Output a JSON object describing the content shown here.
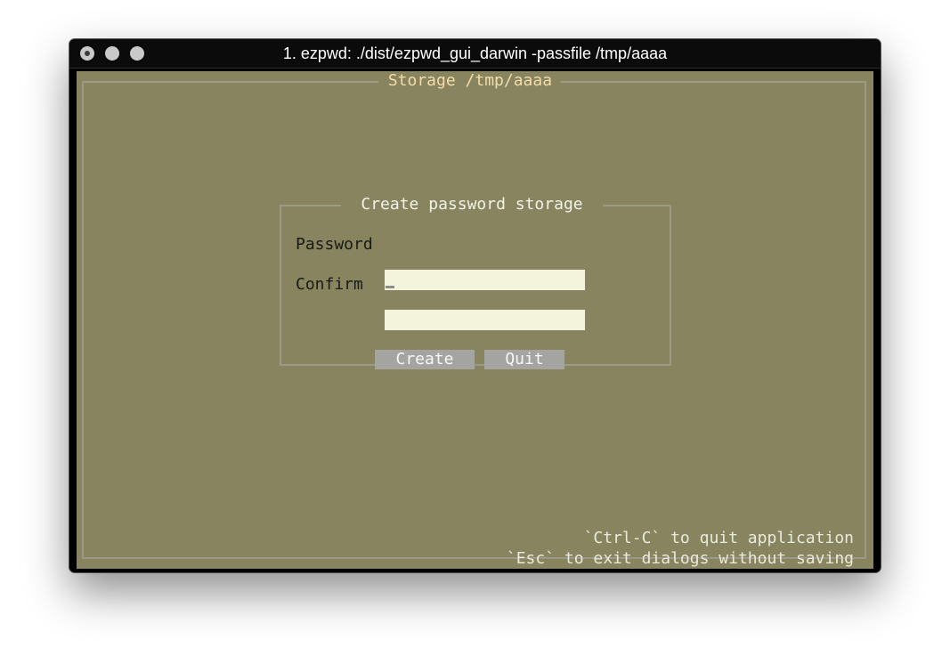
{
  "window": {
    "title": "1. ezpwd: ./dist/ezpwd_gui_darwin -passfile /tmp/aaaa"
  },
  "storage_frame": {
    "title": " Storage /tmp/aaaa "
  },
  "dialog": {
    "title": " Create password storage ",
    "password_label": "Password",
    "password_value": "",
    "confirm_label": "Confirm",
    "confirm_value": "",
    "create_label": "Create",
    "quit_label": "Quit"
  },
  "hints": {
    "ctrl_c": "`Ctrl-C` to quit application",
    "esc": "`Esc` to exit dialogs without saving"
  },
  "colors": {
    "terminal_bg": "#87845f",
    "frame_title": "#f4dcaa",
    "field_bg": "#f4f3dc",
    "button_bg": "#a4a4a0"
  }
}
